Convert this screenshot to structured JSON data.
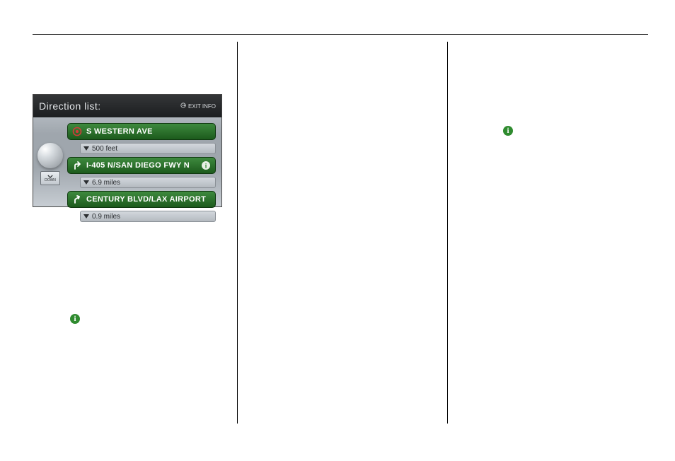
{
  "screenshot": {
    "title": "Direction list:",
    "exit_info_label": "EXIT INFO",
    "down_label": "DOWN",
    "entries": [
      {
        "icon": "origin-dot",
        "label": "S WESTERN AVE",
        "has_info": false
      },
      {
        "dist": "500 feet"
      },
      {
        "icon": "turn-right",
        "label": "I-405 N/SAN DIEGO FWY N",
        "has_info": true
      },
      {
        "dist": "6.9 miles"
      },
      {
        "icon": "turn-right-up",
        "label": "CENTURY BLVD/LAX AIRPORT",
        "has_info": false
      },
      {
        "dist": "0.9 miles"
      }
    ]
  }
}
